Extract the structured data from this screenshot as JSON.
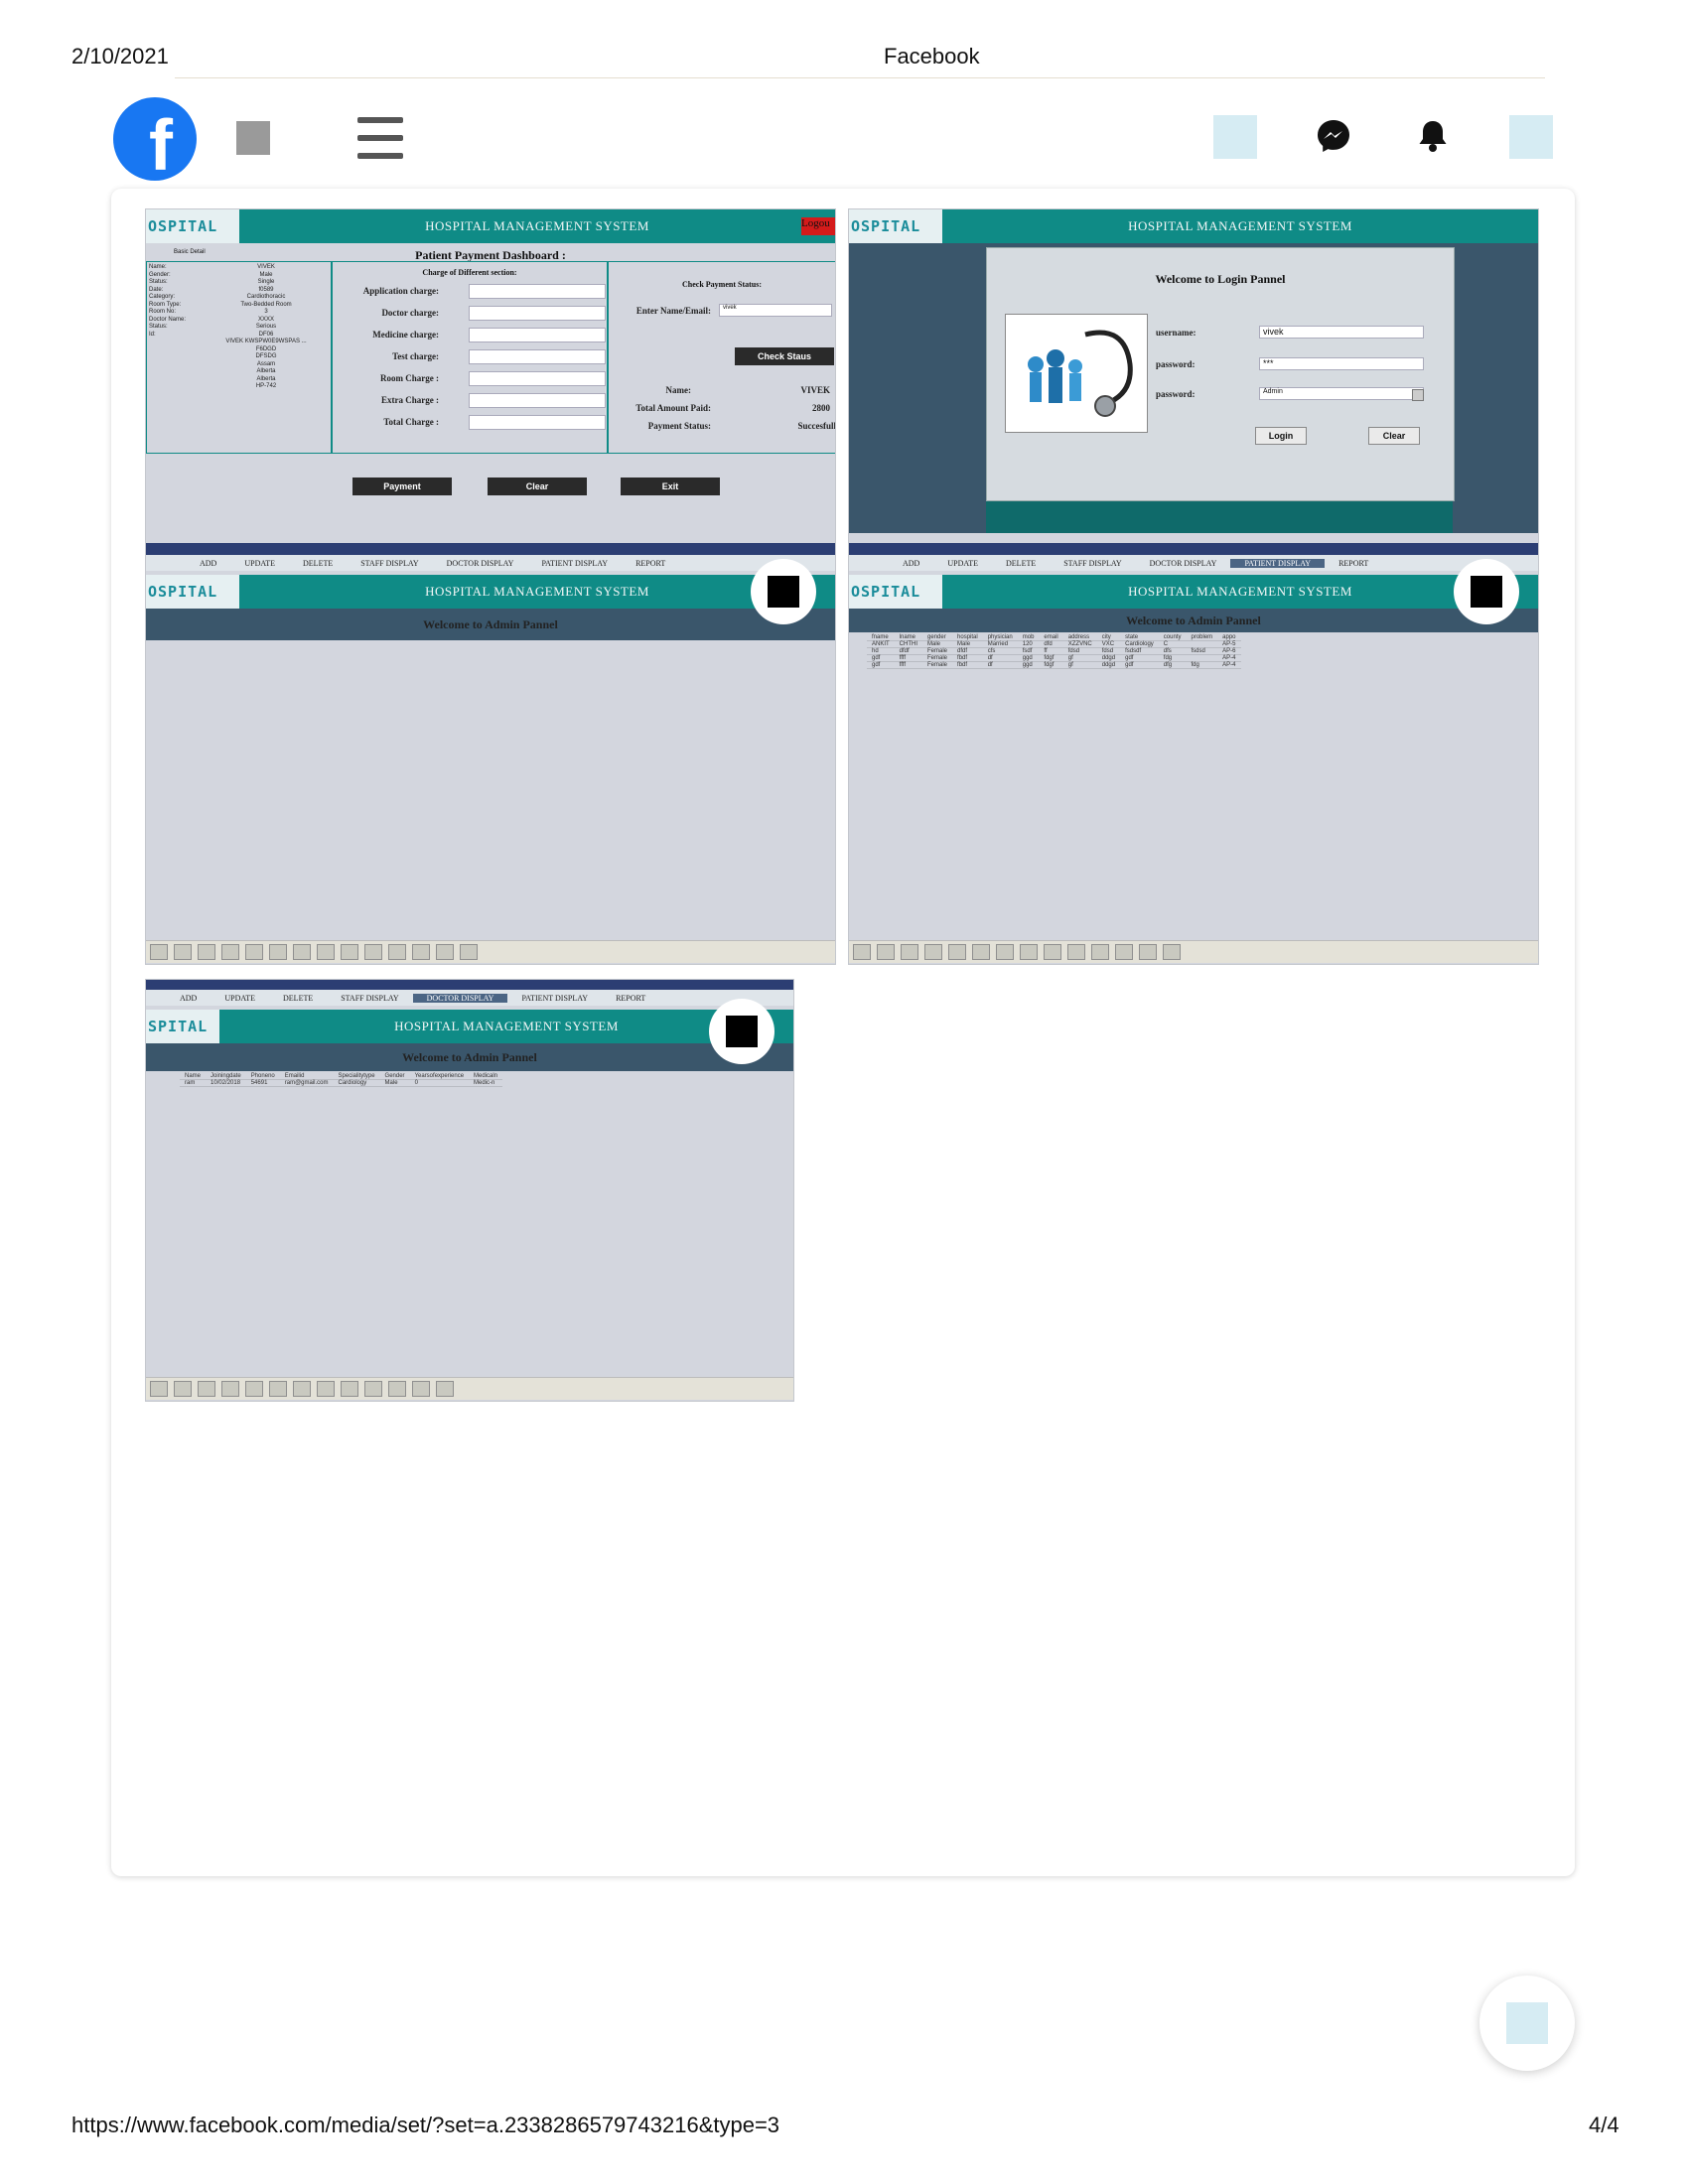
{
  "print_header": {
    "date": "2/10/2021",
    "title": "Facebook"
  },
  "print_footer": {
    "url": "https://www.facebook.com/media/set/?set=a.2338286579743216&type=3",
    "page": "4/4"
  },
  "fb_nav": {
    "logo_letter": "f"
  },
  "hms": {
    "logo": "OSPITAL",
    "logo_b": "SPITAL",
    "title": "HOSPITAL MANAGEMENT SYSTEM",
    "logout": "Logou",
    "menu": [
      "ADD",
      "UPDATE",
      "DELETE",
      "STAFF DISPLAY",
      "DOCTOR DISPLAY",
      "PATIENT DISPLAY",
      "REPORT"
    ],
    "welcome_admin": "Welcome to Admin Pannel"
  },
  "payment": {
    "dashboard_title": "Patient Payment Dashboard :",
    "basic_detail": "Basic Detail",
    "left_labels": [
      "Name:",
      "Gender:",
      "Status:",
      "Date:",
      "Category:",
      "Room Type:",
      "Room No:",
      "Doctor Name:",
      "Status:",
      "Id:"
    ],
    "left_values": [
      "VIVEK",
      "Male",
      "Single",
      "f0589",
      "Cardiothoracic",
      "Two-Bedded Room",
      "3",
      "XXXX",
      "Serious",
      "DF06",
      "VIVEK KWSPW0E9WSPAS ...",
      "F6DGD",
      "DFSDG",
      "Assam",
      "Alberta",
      "Alberta",
      "HP-742"
    ],
    "charges_title": "Charge of Different section:",
    "charges": [
      "Application charge:",
      "Doctor charge:",
      "Medicine charge:",
      "Test charge:",
      "Room Charge :",
      "Extra Charge :",
      "Total Charge :"
    ],
    "check_title": "Check Payment Status:",
    "enter_label": "Enter Name/Email:",
    "enter_value": "vivek",
    "check_btn": "Check Staus",
    "name_label": "Name:",
    "name_value": "VIVEK",
    "total_label": "Total Amount Paid:",
    "total_value": "2800",
    "status_label": "Payment Status:",
    "status_value": "Succesfull",
    "buttons": [
      "Payment",
      "Clear",
      "Exit"
    ]
  },
  "login": {
    "welcome": "Welcome to Login Pannel",
    "username_label": "username:",
    "username_value": "vivek",
    "password_label": "password:",
    "password_value": "***",
    "role_label": "password:",
    "role_value": "Admin",
    "login_btn": "Login",
    "clear_btn": "Clear"
  },
  "patient_table": {
    "headers": [
      "fname",
      "lname",
      "gender",
      "hospital",
      "physician",
      "mob",
      "email",
      "address",
      "city",
      "state",
      "county",
      "problem",
      "appo"
    ],
    "rows": [
      [
        "ANKIT",
        "CHTHI",
        "Male",
        "Male",
        "Married",
        "120",
        "dfd",
        "XZZVNC",
        "VXC",
        "Cardiology",
        "C",
        "",
        "AP-5"
      ],
      [
        "hd",
        "dfdf",
        "Female",
        "dfdf",
        "cfs",
        "fsdf",
        "ff",
        "fdsd",
        "fdsd",
        "fsdsdf",
        "dfs",
        "fsdsd",
        "AP-6"
      ],
      [
        "gdf",
        "ffff",
        "Female",
        "fbdf",
        "df",
        "ggd",
        "fdgf",
        "gf",
        "ddgd",
        "gdf",
        "fdg",
        "",
        "AP-4"
      ],
      [
        "gdf",
        "ffff",
        "Female",
        "fbdf",
        "df",
        "ggd",
        "fdgf",
        "gf",
        "ddgd",
        "gdf",
        "dfg",
        "fdg",
        "AP-4"
      ]
    ]
  },
  "doctor_table": {
    "headers": [
      "Name",
      "Joiningdate",
      "Phoneno",
      "Emailid",
      "Specialitytype",
      "Gender",
      "Yearsofexperience",
      "Medicaln"
    ],
    "rows": [
      [
        "ram",
        "10/02/2018",
        "54691",
        "ram@gmail.com",
        "Cardiology",
        "Male",
        "0",
        "Medic-n"
      ]
    ]
  }
}
